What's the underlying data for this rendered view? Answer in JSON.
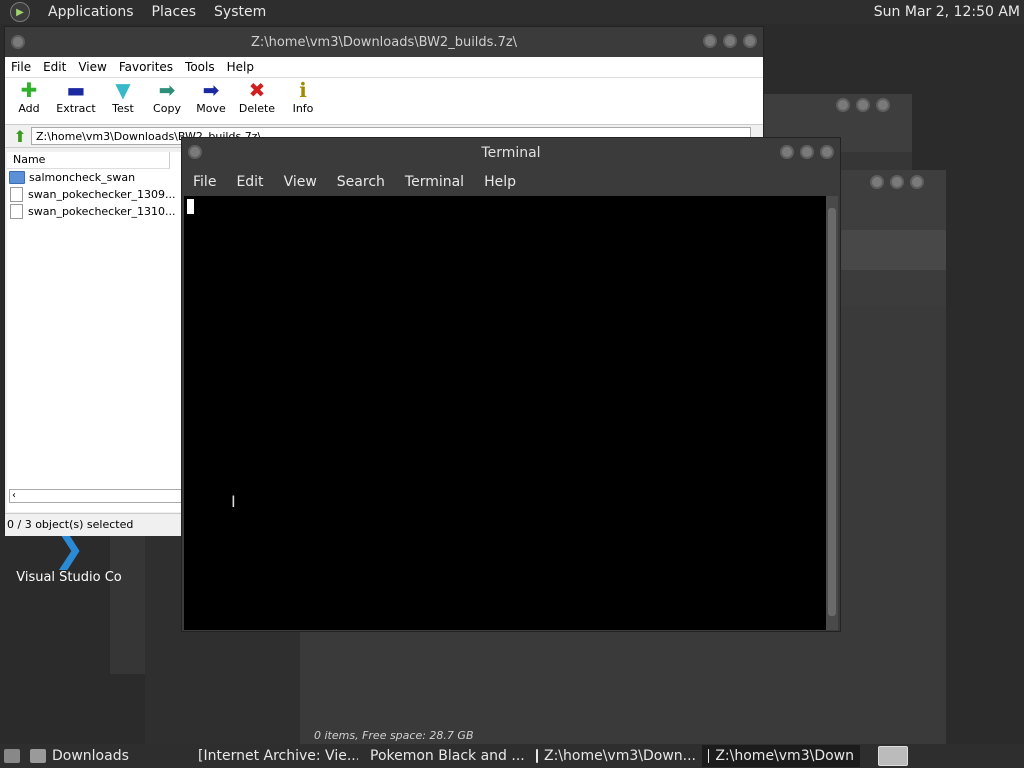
{
  "top_panel": {
    "menu": [
      "Applications",
      "Places",
      "System"
    ],
    "clock": "Sun Mar  2, 12:50 AM"
  },
  "desktop": {
    "vscode_label": "Visual Studio Co"
  },
  "sevenz": {
    "title": "Z:\\home\\vm3\\Downloads\\BW2_builds.7z\\",
    "menu": [
      "File",
      "Edit",
      "View",
      "Favorites",
      "Tools",
      "Help"
    ],
    "tools": [
      {
        "label": "Add",
        "glyph": "✚",
        "color": "#2fb12a"
      },
      {
        "label": "Extract",
        "glyph": "▬",
        "color": "#1b2aa0"
      },
      {
        "label": "Test",
        "glyph": "▼",
        "color": "#38b9c9"
      },
      {
        "label": "Copy",
        "glyph": "➡",
        "color": "#2e8e7a"
      },
      {
        "label": "Move",
        "glyph": "➡",
        "color": "#1b2aa0"
      },
      {
        "label": "Delete",
        "glyph": "✖",
        "color": "#d11f1f"
      },
      {
        "label": "Info",
        "glyph": "ℹ",
        "color": "#a08a00"
      }
    ],
    "address": "Z:\\home\\vm3\\Downloads\\BW2_builds.7z\\",
    "column_name": "Name",
    "files": [
      {
        "name": "salmoncheck_swan",
        "type": "folder"
      },
      {
        "name": "swan_pokechecker_1309...",
        "type": "file"
      },
      {
        "name": "swan_pokechecker_1310...",
        "type": "file"
      }
    ],
    "scroll_left": "‹",
    "status": "0 / 3 object(s) selected"
  },
  "terminal": {
    "title": "Terminal",
    "menu": [
      "File",
      "Edit",
      "View",
      "Search",
      "Terminal",
      "Help"
    ]
  },
  "file_manager_status": "0 items, Free space: 28.7 GB",
  "taskbar": [
    {
      "label": "Downloads",
      "icon_color": "#9a9a9a",
      "active": false
    },
    {
      "label": "[Internet Archive: Vie...",
      "icon_color": "#e46b1c",
      "active": false
    },
    {
      "label": "Pokemon Black and ...",
      "icon_color": "#9a9a9a",
      "active": false
    },
    {
      "label": "Z:\\home\\vm3\\Down...",
      "icon_color": "#e8e8e8",
      "active": false
    },
    {
      "label": "Z:\\home\\vm3\\Down",
      "icon_color": "#e8e8e8",
      "active": true
    }
  ]
}
